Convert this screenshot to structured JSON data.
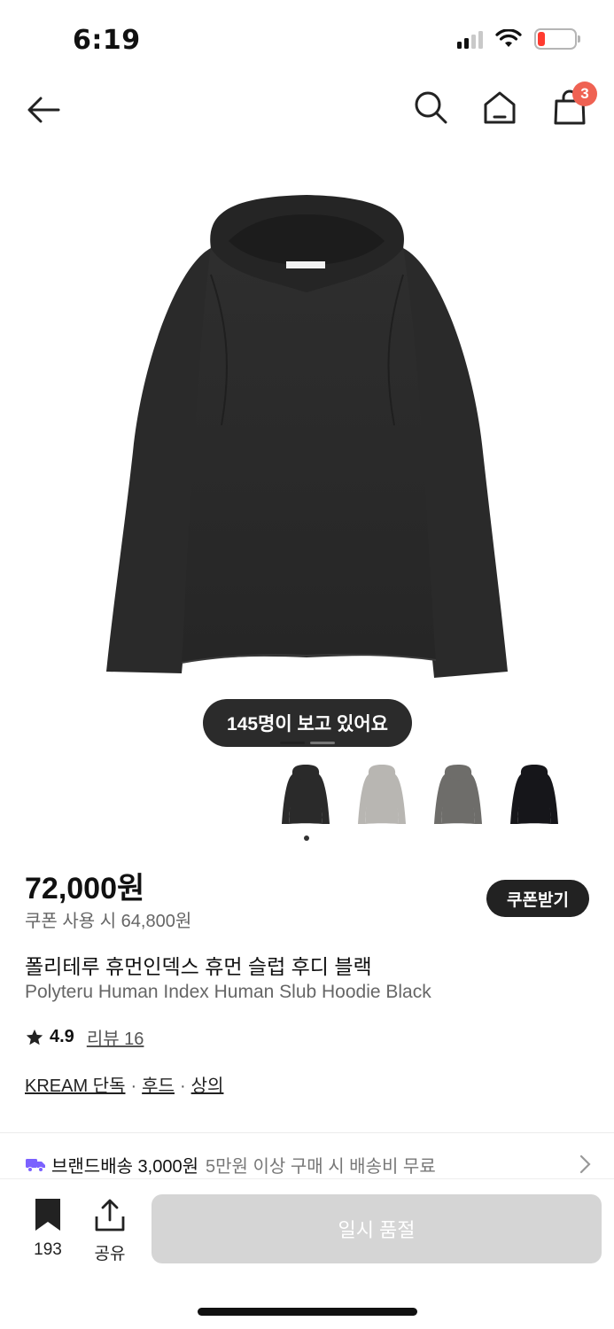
{
  "status_bar": {
    "time": "6:19",
    "icons": [
      "signal-icon",
      "wifi-icon",
      "battery-icon"
    ],
    "battery_level": 0.2
  },
  "nav": {
    "icons": [
      "back-arrow-icon",
      "search-icon",
      "home-icon",
      "shopping-bag-icon"
    ],
    "cart_count": "3"
  },
  "product": {
    "viewing_text": "145명이 보고 있어요",
    "variants": [
      {
        "color": "#2a2a2a",
        "name": "black"
      },
      {
        "color": "#b8b6b2",
        "name": "light-gray"
      },
      {
        "color": "#6e6d6a",
        "name": "charcoal"
      },
      {
        "color": "#16161a",
        "name": "navy-black"
      }
    ],
    "selected_variant": 0,
    "price": "72,000원",
    "coupon_price": "쿠폰 사용 시 64,800원",
    "coupon_button": "쿠폰받기",
    "title_ko": "폴리테루 휴먼인덱스 휴먼 슬럽 후디 블랙",
    "title_en": "Polyteru Human Index Human Slub Hoodie Black",
    "rating": "4.9",
    "review_label": "리뷰 16",
    "tags": [
      "KREAM 단독",
      "후드",
      "상의"
    ],
    "tag_separator": "·"
  },
  "shipping": {
    "brand": "브랜드배송 3,000원",
    "note": "5만원 이상 구매 시 배송비 무료"
  },
  "bottom_bar": {
    "bookmark_count": "193",
    "share_label": "공유",
    "soldout_label": "일시 품절"
  },
  "colors": {
    "badge": "#ef6253",
    "shipping_truck": "#7b61ff",
    "soldout_bg": "#d5d5d5"
  }
}
